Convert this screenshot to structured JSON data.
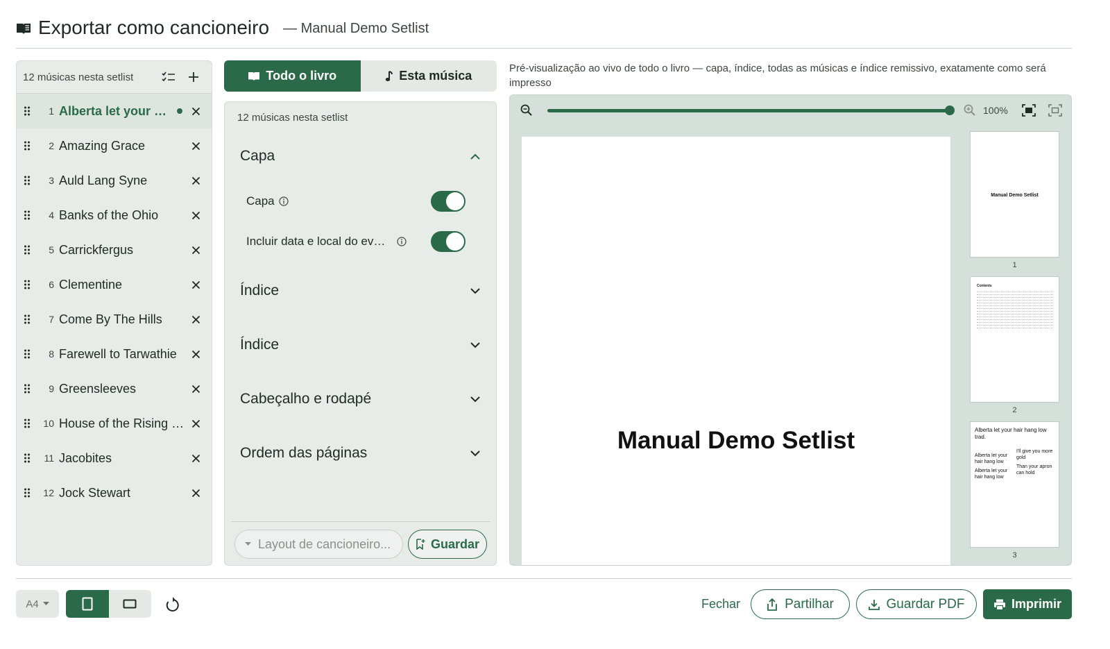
{
  "header": {
    "title": "Exportar como cancioneiro",
    "subtitle": "— Manual Demo Setlist"
  },
  "songs_panel": {
    "count_label": "12 músicas nesta setlist",
    "songs": [
      {
        "num": "1",
        "name": "Alberta let your hair hang low"
      },
      {
        "num": "2",
        "name": "Amazing Grace"
      },
      {
        "num": "3",
        "name": "Auld Lang Syne"
      },
      {
        "num": "4",
        "name": "Banks of the Ohio"
      },
      {
        "num": "5",
        "name": "Carrickfergus"
      },
      {
        "num": "6",
        "name": "Clementine"
      },
      {
        "num": "7",
        "name": "Come By The Hills"
      },
      {
        "num": "8",
        "name": "Farewell to Tarwathie"
      },
      {
        "num": "9",
        "name": "Greensleeves"
      },
      {
        "num": "10",
        "name": "House of the Rising Sun"
      },
      {
        "num": "11",
        "name": "Jacobites"
      },
      {
        "num": "12",
        "name": "Jock Stewart"
      }
    ],
    "active_index": 0
  },
  "mode_tabs": {
    "book": "Todo o livro",
    "song": "Esta música",
    "active": "book"
  },
  "settings": {
    "count_label": "12 músicas nesta setlist",
    "sections": {
      "cover": "Capa",
      "index_1": "Índice",
      "index_2": "Índice",
      "header_footer": "Cabeçalho e rodapé",
      "page_order": "Ordem das páginas"
    },
    "cover_options": {
      "cover_toggle_label": "Capa",
      "cover_toggle_on": true,
      "event_toggle_label": "Incluir data e local do evento",
      "event_toggle_on": true
    },
    "layout_placeholder": "Layout de cancioneiro...",
    "save_label": "Guardar"
  },
  "preview": {
    "description": "Pré-visualização ao vivo de todo o livro — capa, índice, todas as músicas e índice remissivo, exatamente como será impresso",
    "zoom_level": "100%",
    "zoom_fraction": 1.0,
    "cover_title": "Manual Demo Setlist",
    "thumbnails": [
      {
        "number": "1",
        "title": "Manual Demo Setlist"
      },
      {
        "number": "2",
        "title": "Contents"
      },
      {
        "number": "3",
        "title": "Alberta let your hair hang low trad.",
        "col_left": [
          "Alberta let your",
          "hair hang low",
          "Alberta let your",
          "hair hang low"
        ],
        "col_right": [
          "I'll give you more",
          "gold",
          "Than your apron",
          "can hold"
        ]
      }
    ]
  },
  "footer": {
    "paper_size": "A4",
    "orientation": "portrait",
    "close_label": "Fechar",
    "share_label": "Partilhar",
    "save_pdf_label": "Guardar PDF",
    "print_label": "Imprimir"
  },
  "colors": {
    "accent": "#2a6a48",
    "panel_bg": "#e8ece9",
    "preview_bg": "#d6e0da"
  }
}
